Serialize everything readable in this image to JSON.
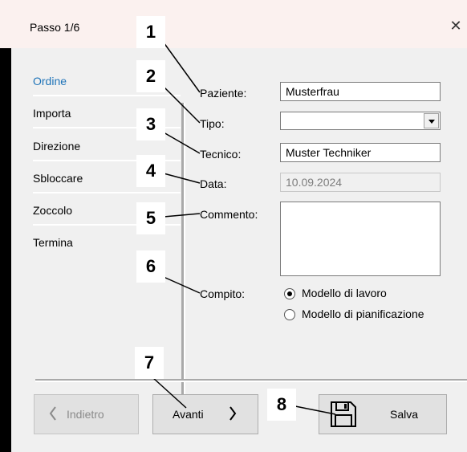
{
  "window": {
    "title": "Passo 1/6",
    "close_glyph": "✕"
  },
  "sidebar": {
    "items": [
      {
        "label": "Ordine",
        "active": true
      },
      {
        "label": "Importa",
        "active": false
      },
      {
        "label": "Direzione",
        "active": false
      },
      {
        "label": "Sbloccare",
        "active": false
      },
      {
        "label": "Zoccolo",
        "active": false
      },
      {
        "label": "Termina",
        "active": false
      }
    ]
  },
  "form": {
    "patient_label": "Paziente:",
    "patient_value": "Musterfrau",
    "type_label": "Tipo:",
    "type_value": "",
    "technician_label": "Tecnico:",
    "technician_value": "Muster Techniker",
    "date_label": "Data:",
    "date_value": "10.09.2024",
    "comment_label": "Commento:",
    "comment_value": "",
    "task_label": "Compito:",
    "task_options": [
      {
        "label": "Modello di lavoro",
        "selected": true
      },
      {
        "label": "Modello di pianificazione",
        "selected": false
      }
    ]
  },
  "buttons": {
    "back_label": "Indietro",
    "back_icon": "chevron-left-icon",
    "next_label": "Avanti",
    "next_icon": "chevron-right-icon",
    "save_label": "Salva",
    "save_icon": "floppy-disk-icon"
  },
  "callouts": [
    "1",
    "2",
    "3",
    "4",
    "5",
    "6",
    "7",
    "8"
  ],
  "colors": {
    "accent": "#1e73b8",
    "title_bar": "#fbf1ef",
    "panel": "#f0f0f0"
  }
}
